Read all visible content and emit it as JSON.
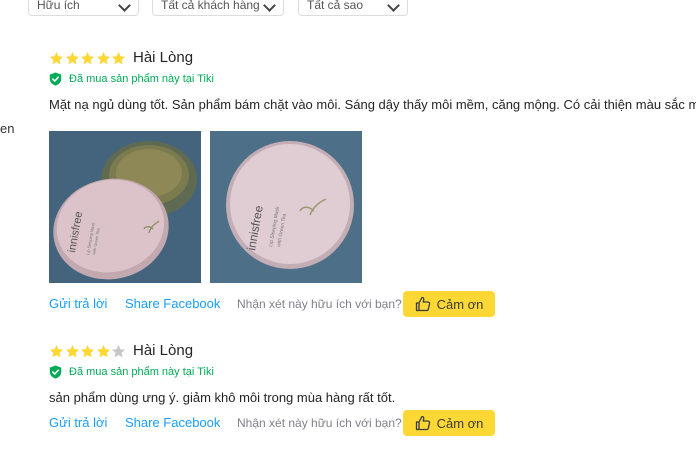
{
  "filters": [
    {
      "label": "Hữu ích"
    },
    {
      "label": "Tất cả khách hàng"
    },
    {
      "label": "Tất cả sao"
    }
  ],
  "left_fragment": "en",
  "colors": {
    "star_filled": "#fdd835",
    "star_empty": "#c7c7c7",
    "verified": "#00ab56",
    "link": "#189eff",
    "thanks_button": "#fdd835"
  },
  "reviews": [
    {
      "rating": 5,
      "title": "Hài Lòng",
      "verified": "Đã mua sản phẩm này tại Tiki",
      "content": "Mặt nạ ngủ dùng tốt. Sản phẩm bám chặt vào môi. Sáng dậy thấy môi mềm, căng mộng. Có cải thiện màu sắc môi.",
      "photos": [
        {
          "brand": "innisfree",
          "line1": "Lip Sleeping Mask",
          "line2": "with Green Tea"
        },
        {
          "brand": "innisfree",
          "line1": "Lip Sleeping Mask",
          "line2": "with Green Tea"
        }
      ],
      "reply_label": "Gửi trả lời",
      "share_label": "Share Facebook",
      "helpful_question": "Nhận xét này hữu ích với bạn?",
      "thanks_label": "Cảm ơn"
    },
    {
      "rating": 4,
      "title": "Hài Lòng",
      "verified": "Đã mua sản phẩm này tại Tiki",
      "content": "sản phẩm dùng ưng ý. giảm khô môi trong mùa hàng rất tốt.",
      "photos": [],
      "reply_label": "Gửi trả lời",
      "share_label": "Share Facebook",
      "helpful_question": "Nhận xét này hữu ích với bạn?",
      "thanks_label": "Cảm ơn"
    }
  ]
}
